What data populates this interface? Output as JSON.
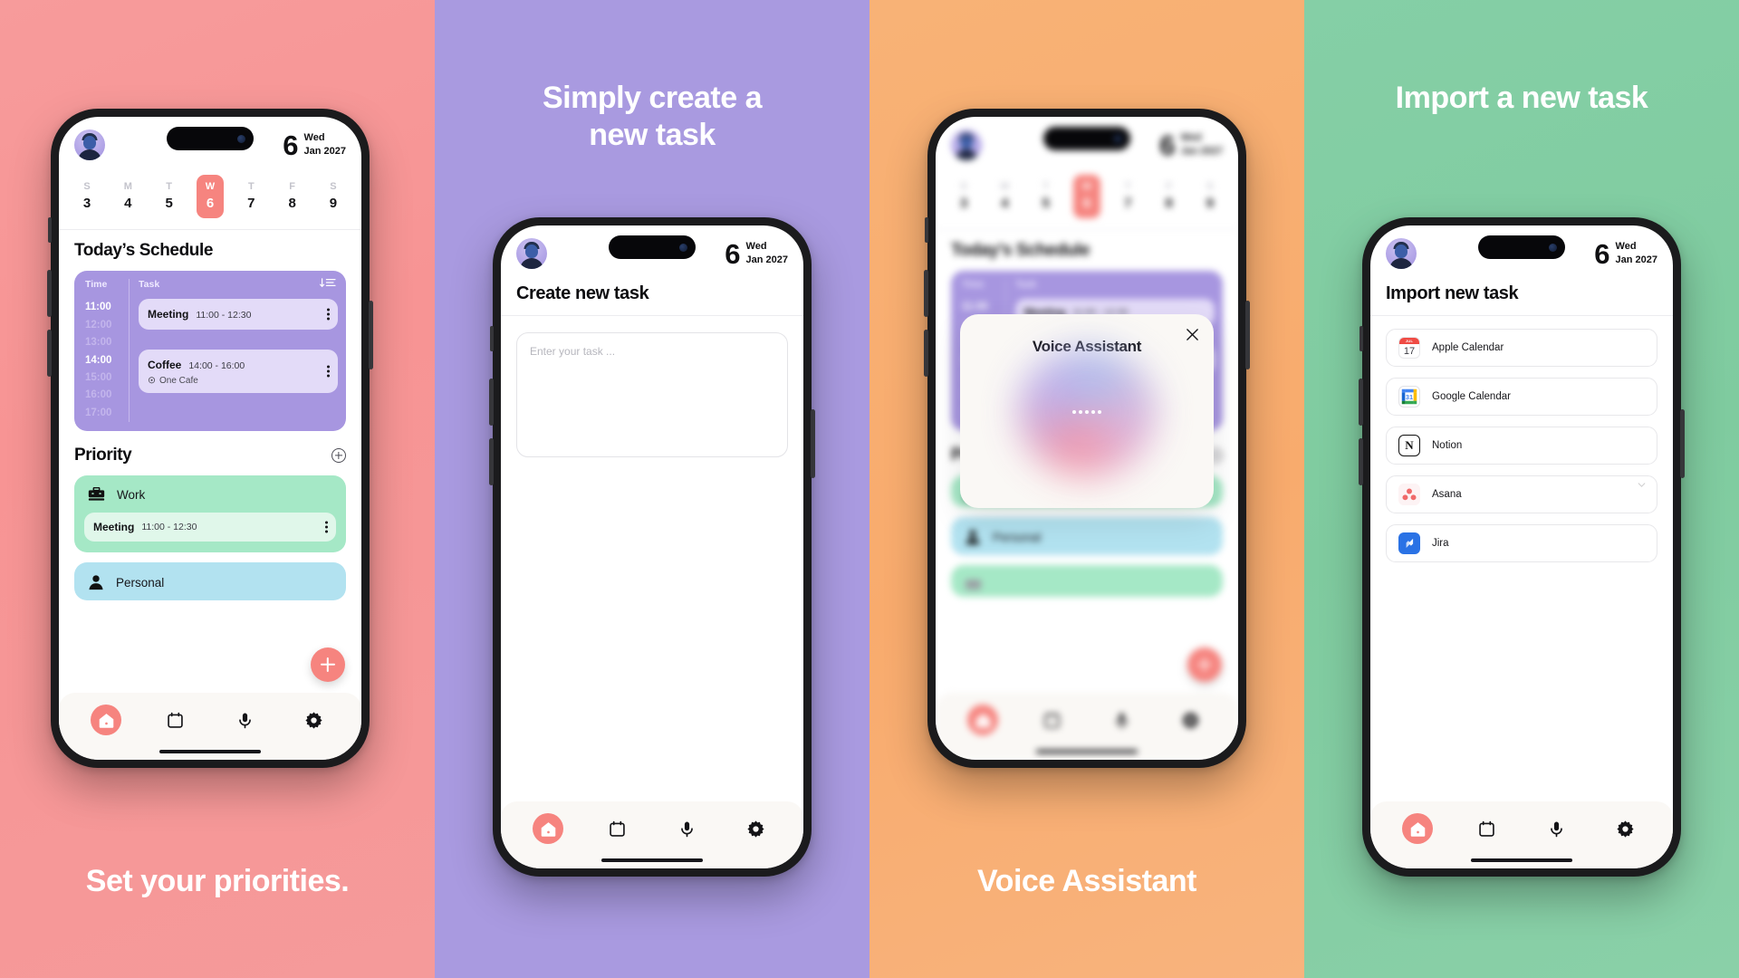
{
  "panels": [
    {
      "id": "priorities",
      "bg": "#f79494",
      "caption": "Set your priorities.",
      "caption_pos": "bottom"
    },
    {
      "id": "create-task",
      "bg": "#a99ae0",
      "caption": "Simply create a\nnew task",
      "caption_line1": "Simply create a",
      "caption_line2": "new task",
      "caption_pos": "top"
    },
    {
      "id": "voice-assistant",
      "bg": "#f8ab6d",
      "caption": "Voice Assistant",
      "caption_pos": "bottom"
    },
    {
      "id": "import-task",
      "bg": "#85cfa6",
      "caption": "Import a new task",
      "caption_pos": "top"
    }
  ],
  "header": {
    "date_number": "6",
    "weekday": "Wed",
    "month_year": "Jan 2027"
  },
  "week": {
    "days": [
      {
        "dow": "S",
        "num": "3",
        "selected": false
      },
      {
        "dow": "M",
        "num": "4",
        "selected": false
      },
      {
        "dow": "T",
        "num": "5",
        "selected": false
      },
      {
        "dow": "W",
        "num": "6",
        "selected": true
      },
      {
        "dow": "T",
        "num": "7",
        "selected": false
      },
      {
        "dow": "F",
        "num": "8",
        "selected": false
      },
      {
        "dow": "S",
        "num": "9",
        "selected": false
      }
    ]
  },
  "schedule": {
    "title": "Today’s Schedule",
    "col_time": "Time",
    "col_task": "Task",
    "times": [
      {
        "label": "11:00",
        "active": true
      },
      {
        "label": "12:00",
        "active": false
      },
      {
        "label": "13:00",
        "active": false
      },
      {
        "label": "14:00",
        "active": true
      },
      {
        "label": "15:00",
        "active": false
      },
      {
        "label": "16:00",
        "active": false
      },
      {
        "label": "17:00",
        "active": false
      }
    ],
    "events": [
      {
        "name": "Meeting",
        "time": "11:00 - 12:30",
        "location": ""
      },
      {
        "name": "Coffee",
        "time": "14:00 - 16:00",
        "location": "One Cafe"
      }
    ]
  },
  "priority": {
    "title": "Priority",
    "groups": [
      {
        "label": "Work",
        "icon": "briefcase-icon",
        "color": "#a5e8c6",
        "items": [
          {
            "name": "Meeting",
            "time": "11:00 - 12:30"
          }
        ]
      },
      {
        "label": "Personal",
        "icon": "person-icon",
        "color": "#b2e2f0",
        "items": []
      }
    ]
  },
  "tabbar": {
    "items": [
      {
        "name": "home",
        "label": "Home",
        "active": true
      },
      {
        "name": "calendar",
        "label": "Calendar",
        "active": false
      },
      {
        "name": "voice",
        "label": "Voice",
        "active": false
      },
      {
        "name": "settings",
        "label": "Settings",
        "active": false
      }
    ]
  },
  "create_task": {
    "title": "Create new task",
    "placeholder": "Enter your task ..."
  },
  "voice_modal": {
    "title": "Voice Assistant",
    "close_label": "×",
    "listening_dots": 5
  },
  "import": {
    "title": "Import new task",
    "sources": [
      {
        "name": "Apple Calendar",
        "icon": "apple-calendar-icon",
        "badge_top": "JUL",
        "badge_num": "17"
      },
      {
        "name": "Google Calendar",
        "icon": "google-calendar-icon",
        "badge_num": "31"
      },
      {
        "name": "Notion",
        "icon": "notion-icon",
        "badge_num": "N"
      },
      {
        "name": "Asana",
        "icon": "asana-icon",
        "has_chevron": true
      },
      {
        "name": "Jira",
        "icon": "jira-icon"
      }
    ]
  },
  "colors": {
    "accent_coral": "#f6847f",
    "purple": "#a796e0",
    "mint": "#a5e8c6",
    "sky": "#b2e2f0",
    "panel_pink": "#f79494",
    "panel_purple": "#a99ae0",
    "panel_orange": "#f8ab6d",
    "panel_green": "#85cfa6"
  }
}
